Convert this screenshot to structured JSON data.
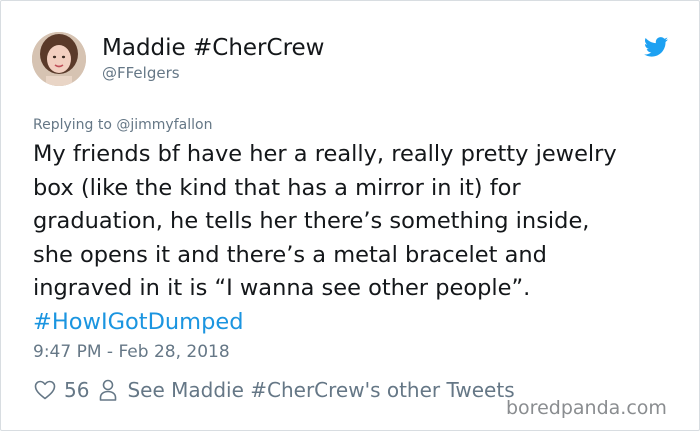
{
  "tweet": {
    "display_name": "Maddie #CherCrew",
    "handle": "@FFelgers",
    "replying_to": "Replying to @jimmyfallon",
    "body_lines": [
      "My friends bf have her a really, really pretty jewelry",
      "box (like the kind that has a mirror in it) for",
      "graduation, he tells her there’s something inside,",
      "she opens it and there’s a metal bracelet and",
      "ingraved in it is “I wanna see other people”."
    ],
    "hashtag": "#HowIGotDumped",
    "timestamp": "9:47 PM - Feb 28, 2018",
    "like_count": "56",
    "see_more_label": "See Maddie #CherCrew's other Tweets",
    "icons": {
      "brand": "twitter-bird-icon",
      "like": "heart-icon",
      "profile": "person-icon"
    }
  },
  "watermark": "boredpanda.com",
  "colors": {
    "text": "#14171a",
    "secondary": "#657786",
    "link": "#1b95e0",
    "border": "#d8dde1"
  }
}
